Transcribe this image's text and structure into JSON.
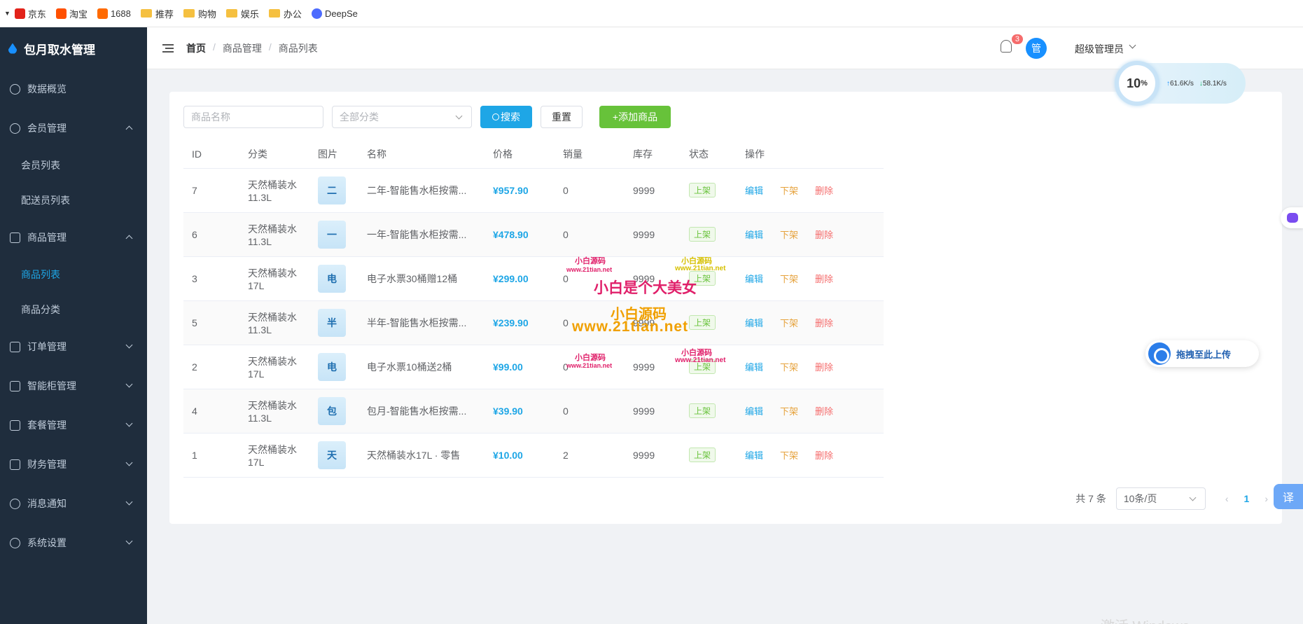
{
  "bookmarks": [
    {
      "label": "京东",
      "color": "#e2231a"
    },
    {
      "label": "淘宝",
      "color": "#ff5000"
    },
    {
      "label": "1688",
      "color": "#ff6a00"
    },
    {
      "label": "推荐",
      "folder": true
    },
    {
      "label": "购物",
      "folder": true
    },
    {
      "label": "娱乐",
      "folder": true
    },
    {
      "label": "办公",
      "folder": true
    },
    {
      "label": "DeepSe",
      "color": "#4d6bfe"
    }
  ],
  "brand": "包月取水管理",
  "menu": {
    "dashboard": "数据概览",
    "member": "会员管理",
    "member_list": "会员列表",
    "courier_list": "配送员列表",
    "goods": "商品管理",
    "goods_list": "商品列表",
    "goods_category": "商品分类",
    "orders": "订单管理",
    "cabinet": "智能柜管理",
    "package": "套餐管理",
    "finance": "财务管理",
    "notify": "消息通知",
    "settings": "系统设置"
  },
  "breadcrumb": [
    "首页",
    "商品管理",
    "商品列表"
  ],
  "header": {
    "badge": "3",
    "avatar_char": "管",
    "user": "超级管理员"
  },
  "speed": {
    "percent": "10",
    "unit": "%",
    "up": "61.6K/s",
    "down": "58.1K/s"
  },
  "toolbar": {
    "name_placeholder": "商品名称",
    "category_placeholder": "全部分类",
    "search": "搜索",
    "reset": "重置",
    "add": "+添加商品"
  },
  "table": {
    "headers": [
      "ID",
      "分类",
      "图片",
      "名称",
      "价格",
      "销量",
      "库存",
      "状态",
      "操作"
    ],
    "rows": [
      {
        "id": "7",
        "cat1": "天然桶装水",
        "cat2": "11.3L",
        "thumb": "二",
        "name": "二年-智能售水柜按需...",
        "price": "¥957.90",
        "sales": "0",
        "stock": "9999",
        "status": "上架"
      },
      {
        "id": "6",
        "cat1": "天然桶装水",
        "cat2": "11.3L",
        "thumb": "一",
        "name": "一年-智能售水柜按需...",
        "price": "¥478.90",
        "sales": "0",
        "stock": "9999",
        "status": "上架"
      },
      {
        "id": "3",
        "cat1": "天然桶装水",
        "cat2": "17L",
        "thumb": "电",
        "name": "电子水票30桶赠12桶",
        "price": "¥299.00",
        "sales": "0",
        "stock": "9999",
        "status": "上架"
      },
      {
        "id": "5",
        "cat1": "天然桶装水",
        "cat2": "11.3L",
        "thumb": "半",
        "name": "半年-智能售水柜按需...",
        "price": "¥239.90",
        "sales": "0",
        "stock": "9999",
        "status": "上架"
      },
      {
        "id": "2",
        "cat1": "天然桶装水",
        "cat2": "17L",
        "thumb": "电",
        "name": "电子水票10桶送2桶",
        "price": "¥99.00",
        "sales": "0",
        "stock": "9999",
        "status": "上架"
      },
      {
        "id": "4",
        "cat1": "天然桶装水",
        "cat2": "11.3L",
        "thumb": "包",
        "name": "包月-智能售水柜按需...",
        "price": "¥39.90",
        "sales": "0",
        "stock": "9999",
        "status": "上架"
      },
      {
        "id": "1",
        "cat1": "天然桶装水",
        "cat2": "17L",
        "thumb": "天",
        "name": "天然桶装水17L · 零售",
        "price": "¥10.00",
        "sales": "2",
        "stock": "9999",
        "status": "上架"
      }
    ],
    "actions": {
      "edit": "编辑",
      "off": "下架",
      "del": "删除"
    }
  },
  "pager": {
    "total": "共 7 条",
    "page_size": "10条/页",
    "current": "1"
  },
  "upload": "拖拽至此上传",
  "translate": "译",
  "watermarks": {
    "small_1": "小白源码",
    "small_url_1": "www.21tian.net",
    "small_2": "小白源码",
    "small_url_2": "www.21tian.net",
    "big_1": "小白是个大美女",
    "big_2": "小白源码",
    "big_url": "www.21tian.net",
    "small_3": "小白源码",
    "small_url_3": "www.21tian.net",
    "small_4": "小白源码",
    "small_url_4": "www.21tian.net"
  },
  "windows_mark": "激活 Windows",
  "colors": {
    "sidebar": "#1f2d3d",
    "accent": "#1ea6e6",
    "green": "#67c23a",
    "warning": "#e6a23c",
    "danger": "#f56c6c"
  }
}
